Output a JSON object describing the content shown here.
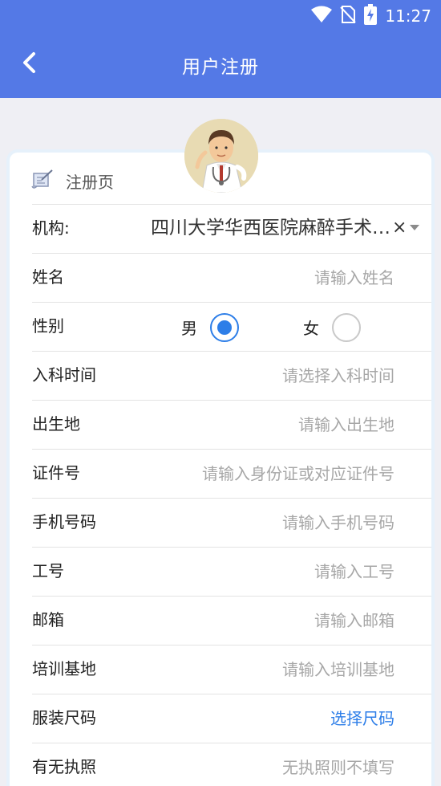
{
  "status_bar": {
    "time": "11:27",
    "icons": [
      "wifi-icon",
      "no-sim-icon",
      "battery-charging-icon"
    ]
  },
  "header": {
    "title": "用户注册",
    "back_icon": "chevron-left-icon"
  },
  "colors": {
    "primary": "#5479e6",
    "accent": "#2d7ee8",
    "placeholder": "#a7a7a7"
  },
  "card": {
    "title": "注册页",
    "icon": "scroll-pen-icon",
    "avatar": "doctor-avatar"
  },
  "form": {
    "org": {
      "label": "机构:",
      "value": "四川大学华西医院麻醉手术中心"
    },
    "name": {
      "label": "姓名",
      "placeholder": "请输入姓名"
    },
    "gender": {
      "label": "性别",
      "male": "男",
      "female": "女",
      "selected": "男"
    },
    "entry_date": {
      "label": "入科时间",
      "placeholder": "请选择入科时间"
    },
    "birthplace": {
      "label": "出生地",
      "placeholder": "请输入出生地"
    },
    "id_number": {
      "label": "证件号",
      "placeholder": "请输入身份证或对应证件号"
    },
    "phone": {
      "label": "手机号码",
      "placeholder": "请输入手机号码"
    },
    "staff_id": {
      "label": "工号",
      "placeholder": "请输入工号"
    },
    "email": {
      "label": "邮箱",
      "placeholder": "请输入邮箱"
    },
    "training_base": {
      "label": "培训基地",
      "placeholder": "请输入培训基地"
    },
    "uniform_size": {
      "label": "服装尺码",
      "action": "选择尺码"
    },
    "license": {
      "label": "有无执照",
      "placeholder": "无执照则不填写"
    }
  }
}
